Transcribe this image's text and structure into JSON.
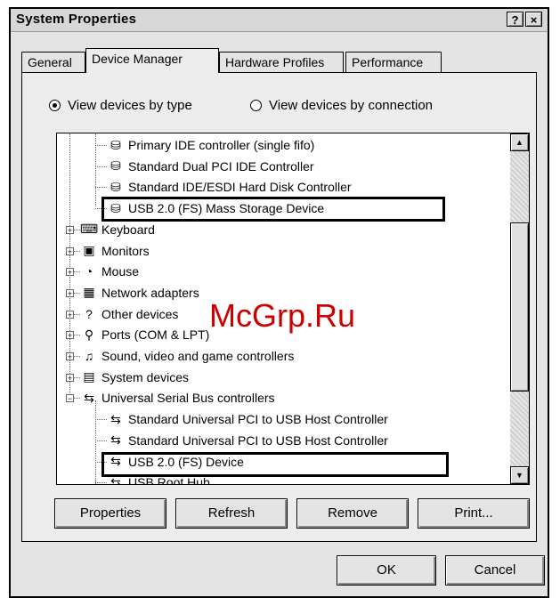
{
  "window": {
    "title": "System Properties",
    "help_label": "?",
    "close_label": "×"
  },
  "tabs": [
    {
      "label": "General"
    },
    {
      "label": "Device Manager"
    },
    {
      "label": "Hardware Profiles"
    },
    {
      "label": "Performance"
    }
  ],
  "view": {
    "by_type": "View devices by type",
    "by_connection": "View devices by connection",
    "selected": "by_type"
  },
  "tree": {
    "rows": [
      {
        "label": "Primary IDE controller (single fifo)",
        "icon": "disk-controller-icon",
        "level": 2
      },
      {
        "label": "Standard Dual PCI IDE Controller",
        "icon": "disk-controller-icon",
        "level": 2
      },
      {
        "label": "Standard IDE/ESDI Hard Disk Controller",
        "icon": "disk-controller-icon",
        "level": 2
      },
      {
        "label": "USB 2.0 (FS) Mass Storage Device",
        "icon": "disk-controller-icon",
        "level": 2
      },
      {
        "label": "Keyboard",
        "icon": "keyboard-icon",
        "level": 1
      },
      {
        "label": "Monitors",
        "icon": "monitor-icon",
        "level": 1
      },
      {
        "label": "Mouse",
        "icon": "mouse-icon",
        "level": 1
      },
      {
        "label": "Network adapters",
        "icon": "network-icon",
        "level": 1
      },
      {
        "label": "Other devices",
        "icon": "question-icon",
        "level": 1
      },
      {
        "label": "Ports (COM & LPT)",
        "icon": "port-icon",
        "level": 1
      },
      {
        "label": "Sound, video and game controllers",
        "icon": "sound-icon",
        "level": 1
      },
      {
        "label": "System devices",
        "icon": "computer-icon",
        "level": 1
      },
      {
        "label": "Universal Serial Bus controllers",
        "icon": "usb-icon",
        "level": 1
      },
      {
        "label": "Standard Universal PCI to USB Host Controller",
        "icon": "usb-icon",
        "level": 2
      },
      {
        "label": "Standard Universal PCI to USB Host Controller",
        "icon": "usb-icon",
        "level": 2
      },
      {
        "label": "USB 2.0 (FS) Device",
        "icon": "usb-icon",
        "level": 2
      },
      {
        "label": "USB Root Hub",
        "icon": "usb-icon",
        "level": 2
      }
    ]
  },
  "watermark": "McGrp.Ru",
  "buttons": {
    "properties": "Properties",
    "refresh": "Refresh",
    "remove": "Remove",
    "print": "Print...",
    "ok": "OK",
    "cancel": "Cancel"
  },
  "colors": {
    "watermark": "#cc0000"
  }
}
